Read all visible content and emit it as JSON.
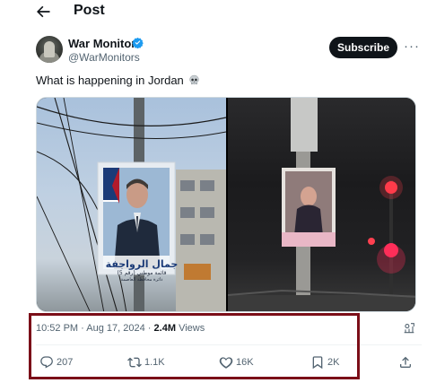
{
  "header": {
    "title": "Post"
  },
  "author": {
    "name": "War Monitor",
    "handle": "@WarMonitors",
    "verified_color": "#1d9bf0"
  },
  "subscribe_label": "Subscribe",
  "tweet": {
    "text": "What is happening in Jordan"
  },
  "poster": {
    "name_arabic": "جمال الرواجفة",
    "line2": "قائمة موطني (رقم 5)",
    "line3": "دائرة محافظة العاصمة"
  },
  "meta": {
    "time": "10:52 PM",
    "separator": "·",
    "date": "Aug 17, 2024",
    "views_count": "2.4M",
    "views_label": "Views"
  },
  "stats": {
    "replies": "207",
    "reposts": "1.1K",
    "likes": "16K",
    "bookmarks": "2K"
  },
  "colors": {
    "highlight": "#7b0e18",
    "accent": "#1d9bf0",
    "text": "#0f1419",
    "muted": "#536471"
  }
}
